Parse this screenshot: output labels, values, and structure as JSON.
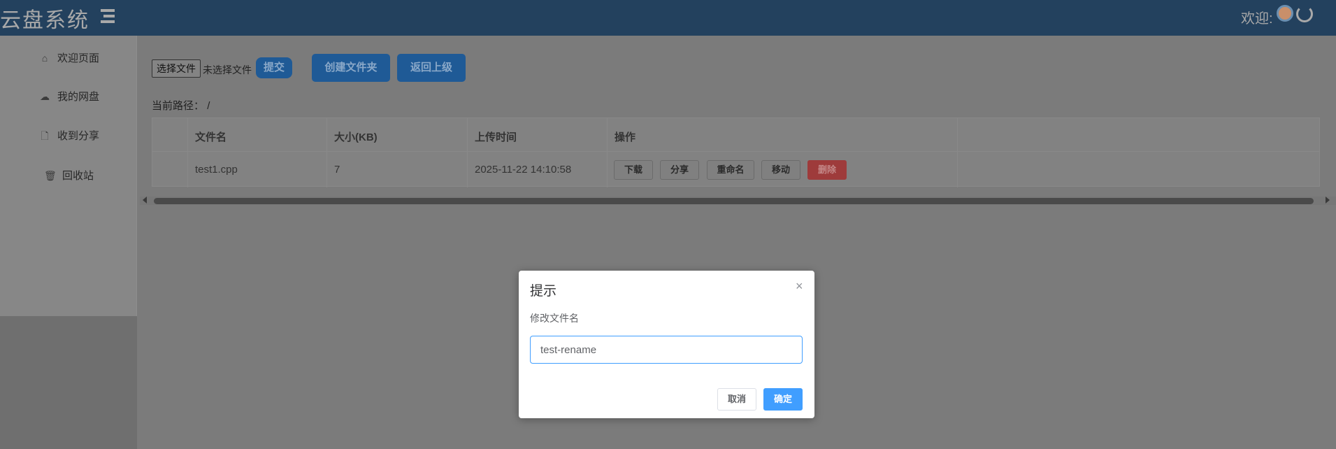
{
  "header": {
    "logo": "云盘系统",
    "welcome": "欢迎:"
  },
  "sidebar": {
    "items": [
      {
        "label": "欢迎页面",
        "icon": "home-icon"
      },
      {
        "label": "我的网盘",
        "icon": "cloud-icon"
      },
      {
        "label": "收到分享",
        "icon": "file-add-icon"
      },
      {
        "label": "回收站",
        "icon": "trash-icon"
      }
    ]
  },
  "toolbar": {
    "choose_file": "选择文件",
    "no_file": "未选择文件",
    "submit": "提交",
    "create_folder": "创建文件夹",
    "go_up": "返回上级"
  },
  "path": {
    "label": "当前路径：",
    "value": "/"
  },
  "table": {
    "headers": [
      "文件名",
      "大小(KB)",
      "上传时间",
      "操作"
    ],
    "rows": [
      {
        "name": "test1.cpp",
        "size": "7",
        "time": "2025-11-22 14:10:58"
      }
    ],
    "actions": [
      "下载",
      "分享",
      "重命名",
      "移动",
      "删除"
    ]
  },
  "colors": {
    "header": "#23415e",
    "primary": "#409eff",
    "danger": "#9e3b3b"
  },
  "dialog": {
    "title": "提示",
    "close": "×",
    "message": "修改文件名",
    "input_value": "test-rename",
    "cancel": "取消",
    "confirm": "确定"
  }
}
